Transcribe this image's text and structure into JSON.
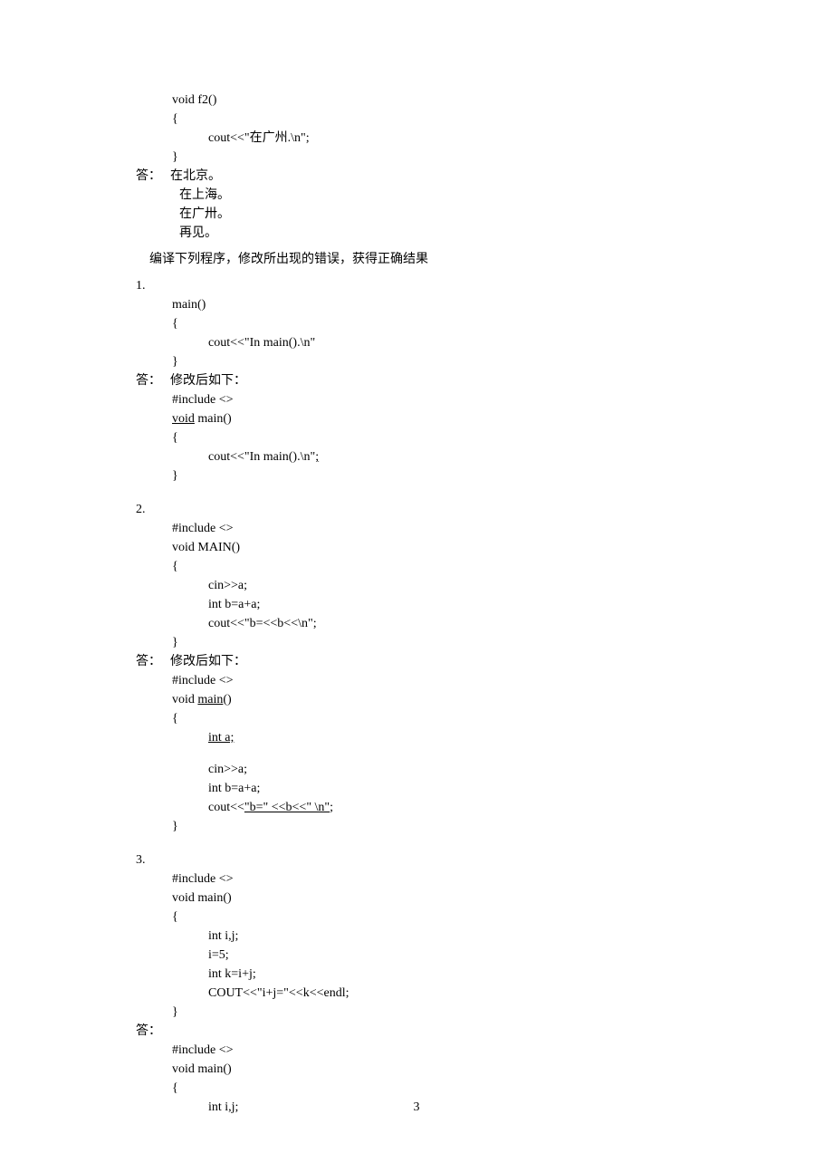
{
  "top_code": {
    "l1": "void f2()",
    "l2": "{",
    "l3": "cout<<\"在广州.\\n\";",
    "l4": "}"
  },
  "answer_top": {
    "label": "答：",
    "l1": "在北京。",
    "l2": "在上海。",
    "l3": "在广卅。",
    "l4": "再见。"
  },
  "section_title": "编译下列程序，修改所出现的错误，获得正确结果",
  "p1": {
    "num": "1.",
    "code": {
      "l1": "main()",
      "l2": "{",
      "l3": "cout<<\"In main().\\n\"",
      "l4": "}"
    },
    "ans_label": "答：",
    "ans_text": "修改后如下：",
    "fix": {
      "l1": "#include <>",
      "l2a": "void",
      "l2b": " main()",
      "l3": "{",
      "l4a": "cout<<\"In main().\\n\"",
      "l4b": ";",
      "l5": "}"
    }
  },
  "p2": {
    "num": "2.",
    "code": {
      "l1": "#include <>",
      "l2": "void MAIN()",
      "l3": "{",
      "l4": "cin>>a;",
      "l5": "int b=a+a;",
      "l6": "cout<<\"b=<<b<<\\n\";",
      "l7": "}"
    },
    "ans_label": "答：",
    "ans_text": "修改后如下：",
    "fix": {
      "l1": "#include <>",
      "l2a": "void ",
      "l2b": "main",
      "l2c": "()",
      "l3": "{",
      "l4": "int a;",
      "l5": "cin>>a;",
      "l6": "int b=a+a;",
      "l7a": "cout<<",
      "l7b": "\"b=\" <<b<<\" \\n\"",
      "l7c": ";",
      "l8": "}"
    }
  },
  "p3": {
    "num": "3.",
    "code": {
      "l1": "#include <>",
      "l2": "void main()",
      "l3": "{",
      "l4": "int i,j;",
      "l5": "i=5;",
      "l6": "int k=i+j;",
      "l7": "COUT<<\"i+j=\"<<k<<endl;",
      "l8": "}"
    },
    "ans_label": "答：",
    "fix": {
      "l1": "#include <>",
      "l2": "void main()",
      "l3": "{",
      "l4": "int i,j;"
    }
  },
  "page_number": "3"
}
